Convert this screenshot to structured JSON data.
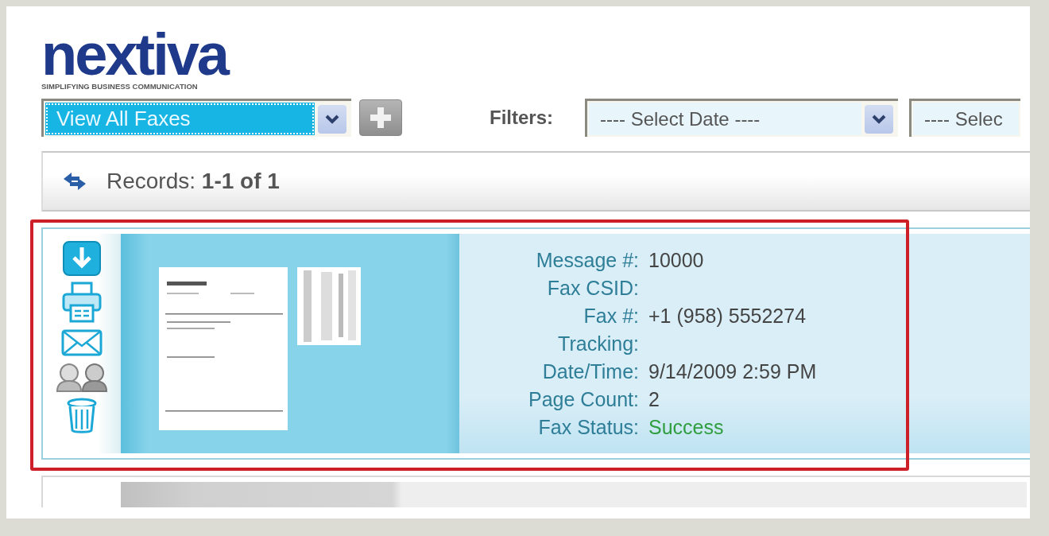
{
  "logo": {
    "name": "nextiva",
    "tagline": "SIMPLIFYING BUSINESS COMMUNICATION"
  },
  "view_select": {
    "value": "View All Faxes",
    "selected": true
  },
  "filters": {
    "label": "Filters:",
    "selects": [
      {
        "value": "---- Select Date ----"
      },
      {
        "value": "---- Selec"
      }
    ]
  },
  "records_bar": {
    "label": "Records:",
    "range": "1-1 of 1"
  },
  "records": [
    {
      "highlighted": true,
      "actions": [
        {
          "kind": "download"
        },
        {
          "kind": "print"
        },
        {
          "kind": "email"
        },
        {
          "kind": "contacts"
        },
        {
          "kind": "delete"
        }
      ],
      "fields": [
        {
          "label": "Message #:",
          "value": "10000"
        },
        {
          "label": "Fax CSID:"
        },
        {
          "label": "Fax #:",
          "value": "+1 (958) 5552274"
        },
        {
          "label": "Tracking:"
        },
        {
          "label": "Date/Time:",
          "value": "9/14/2009 2:59 PM"
        },
        {
          "label": "Page Count:",
          "value": "2"
        },
        {
          "label": "Fax Status:",
          "value": "Success",
          "kind": "success"
        }
      ]
    },
    {
      "highlighted": false,
      "collapsed": true
    }
  ]
}
